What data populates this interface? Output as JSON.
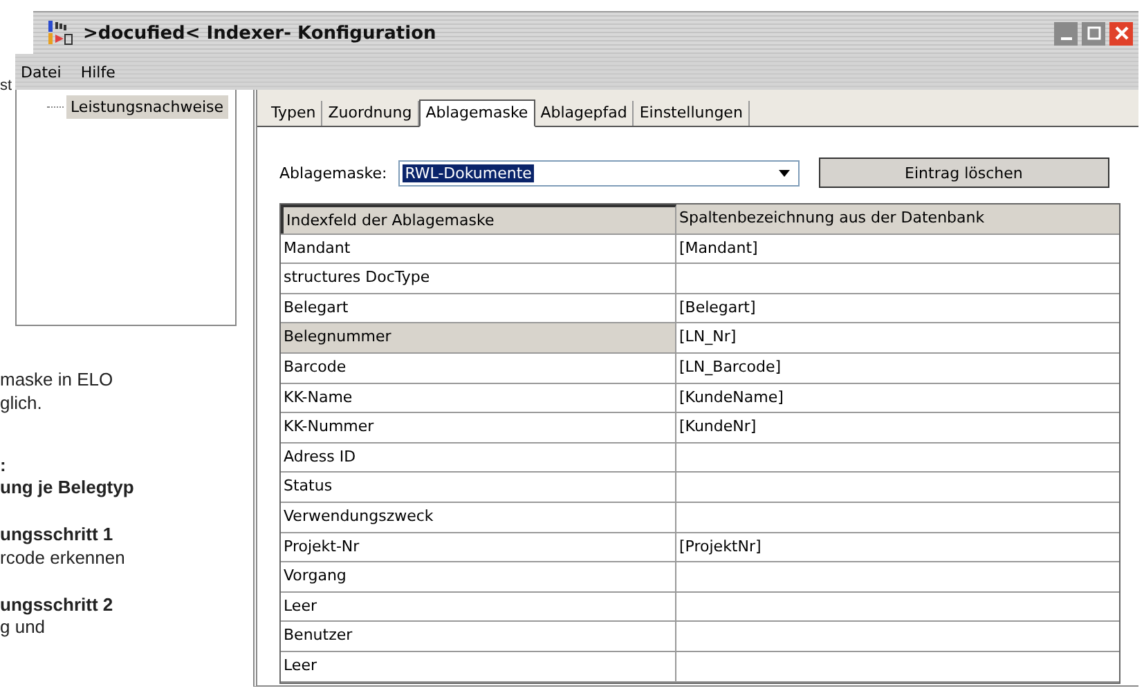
{
  "background_document": {
    "lines": [
      {
        "text": "st",
        "bold": false
      },
      {
        "text": "maske in ELO",
        "bold": false
      },
      {
        "text": "glich.",
        "bold": false
      },
      {
        "text": ":",
        "bold": true
      },
      {
        "text": "ung je Belegtyp",
        "bold": true
      },
      {
        "text": "ungsschritt 1",
        "bold": true
      },
      {
        "text": "rcode erkennen",
        "bold": false
      },
      {
        "text": "ungsschritt 2",
        "bold": true
      },
      {
        "text": "g und",
        "bold": false
      }
    ]
  },
  "window": {
    "title": ">docufied< Indexer- Konfiguration"
  },
  "menu": [
    "Datei",
    "Hilfe"
  ],
  "tree": {
    "items": [
      {
        "label": "Leistungsnachweise",
        "selected": true
      }
    ]
  },
  "tabs": [
    {
      "label": "Typen",
      "selected": false
    },
    {
      "label": "Zuordnung",
      "selected": false
    },
    {
      "label": "Ablagemaske",
      "selected": true
    },
    {
      "label": "Ablagepfad",
      "selected": false
    },
    {
      "label": "Einstellungen",
      "selected": false
    }
  ],
  "mask_field": {
    "label": "Ablagemaske:",
    "value": "RWL-Dokumente"
  },
  "delete_button": "Eintrag löschen",
  "table": {
    "columns": [
      "Indexfeld der Ablagemaske",
      "Spaltenbezeichnung aus der Datenbank"
    ],
    "rows": [
      {
        "field": "Mandant",
        "column": "[Mandant]",
        "selected": false
      },
      {
        "field": "structures DocType",
        "column": "",
        "selected": false
      },
      {
        "field": "Belegart",
        "column": "[Belegart]",
        "selected": false
      },
      {
        "field": "Belegnummer",
        "column": "[LN_Nr]",
        "selected": true
      },
      {
        "field": "Barcode",
        "column": "[LN_Barcode]",
        "selected": false
      },
      {
        "field": "KK-Name",
        "column": "[KundeName]",
        "selected": false
      },
      {
        "field": "KK-Nummer",
        "column": "[KundeNr]",
        "selected": false
      },
      {
        "field": "Adress ID",
        "column": "",
        "selected": false
      },
      {
        "field": "Status",
        "column": "",
        "selected": false
      },
      {
        "field": "Verwendungszweck",
        "column": "",
        "selected": false
      },
      {
        "field": "Projekt-Nr",
        "column": "[ProjektNr]",
        "selected": false
      },
      {
        "field": "Vorgang",
        "column": "",
        "selected": false
      },
      {
        "field": "Leer",
        "column": "",
        "selected": false
      },
      {
        "field": "Benutzer",
        "column": "",
        "selected": false
      },
      {
        "field": "Leer",
        "column": "",
        "selected": false
      }
    ]
  }
}
